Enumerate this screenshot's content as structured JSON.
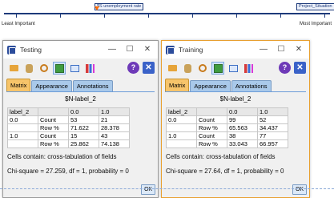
{
  "strip": {
    "chip_left": "$S unemployment rate",
    "chip_right": "Project_Situation",
    "left_label": "Least Important",
    "right_label": "Most Important",
    "accent": "#1d3a7a",
    "marker_color": "#ff6a00"
  },
  "windows": [
    {
      "title": "Testing",
      "caption": "$N-label_2",
      "tabs": [
        "Matrix",
        "Appearance",
        "Annotations"
      ],
      "table": {
        "col_headers": [
          "label_2",
          "",
          "0.0",
          "1.0"
        ],
        "rows": [
          [
            "0.0",
            "Count",
            "53",
            "21"
          ],
          [
            "",
            "Row %",
            "71.622",
            "28.378"
          ],
          [
            "1.0",
            "Count",
            "15",
            "43"
          ],
          [
            "",
            "Row %",
            "25.862",
            "74.138"
          ]
        ]
      },
      "cells_note": "Cells contain: cross-tabulation of fields",
      "chi": "Chi-square = 27.259, df = 1, probability = 0",
      "ok": "OK"
    },
    {
      "title": "Training",
      "caption": "$N-label_2",
      "tabs": [
        "Matrix",
        "Appearance",
        "Annotations"
      ],
      "table": {
        "col_headers": [
          "label_2",
          "",
          "0.0",
          "1.0"
        ],
        "rows": [
          [
            "0.0",
            "Count",
            "99",
            "52"
          ],
          [
            "",
            "Row %",
            "65.563",
            "34.437"
          ],
          [
            "1.0",
            "Count",
            "38",
            "77"
          ],
          [
            "",
            "Row %",
            "33.043",
            "66.957"
          ]
        ]
      },
      "cells_note": "Cells contain: cross-tabulation of fields",
      "chi": "Chi-square = 27.64, df = 1, probability = 0",
      "ok": "OK"
    }
  ],
  "controls": {
    "minimize": "—",
    "maximize": "☐",
    "close": "✕",
    "help": "?",
    "dialog_close": "✕"
  },
  "icons": [
    "folder-icon",
    "database-icon",
    "refresh-icon",
    "tile-icon",
    "dashboard-icon",
    "chart-icon",
    "help-icon",
    "close-icon"
  ]
}
